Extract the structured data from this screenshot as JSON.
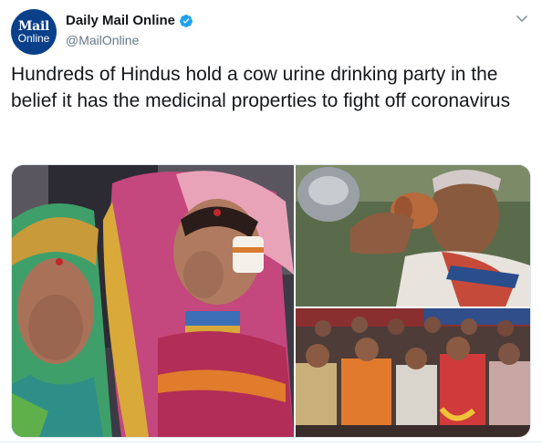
{
  "account": {
    "avatar_line1": "Mail",
    "avatar_line2": "Online",
    "display_name": "Daily Mail Online",
    "handle": "@MailOnline",
    "verified": true
  },
  "tweet": {
    "text": "Hundreds of Hindus hold a cow urine drinking party in the belief it has the medicinal properties to fight off coronavirus"
  },
  "media": {
    "photo_count": 3
  },
  "colors": {
    "avatar_bg": "#0a3f8a",
    "verified_blue": "#1da1f2",
    "handle_gray": "#657786",
    "text": "#14171a"
  },
  "icons": {
    "verified": "verified-badge-icon",
    "menu": "chevron-down-icon"
  }
}
